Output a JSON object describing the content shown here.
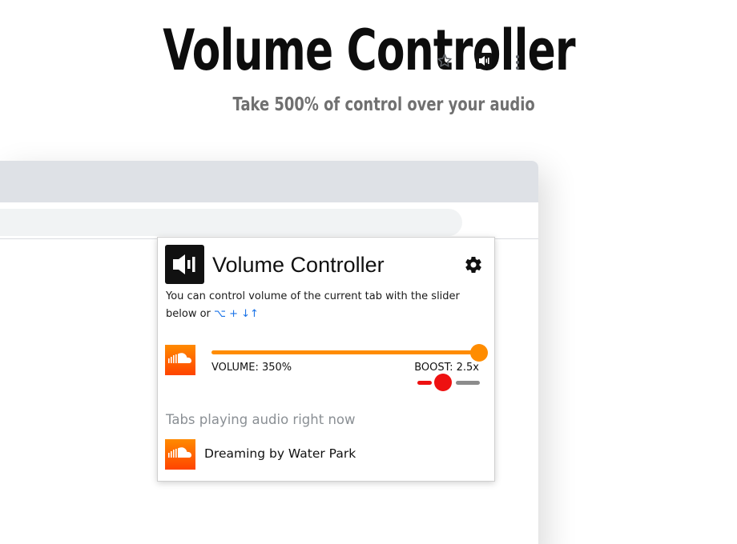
{
  "hero": {
    "title": "Volume Controller",
    "subtitle": "Take 500% of control over your audio"
  },
  "browser": {
    "toolbar_icons": [
      "star-icon",
      "volume-extension-icon",
      "more-vert-icon"
    ]
  },
  "popup": {
    "logo_icon": "speaker-icon",
    "title": "Volume Controller",
    "settings_icon": "gear-icon",
    "description": "You can control volume of the current tab with the slider below or ",
    "shortcut": "⌥ + ↓↑",
    "current_tab": {
      "favicon": "soundcloud-icon",
      "volume_label": "VOLUME: 350%",
      "volume_percent": 350,
      "volume_max_percent": 500,
      "boost_label": "BOOST: 2.5x",
      "boost_value": 2.5
    },
    "tabs_heading": "Tabs playing audio right now",
    "tabs": [
      {
        "favicon": "soundcloud-icon",
        "title": "Dreaming by Water Park"
      }
    ],
    "colors": {
      "volume_accent": "#ff8c00",
      "boost_accent": "#ee1111",
      "shortcut_link": "#1a73e8",
      "soundcloud": "#ff5500"
    }
  }
}
